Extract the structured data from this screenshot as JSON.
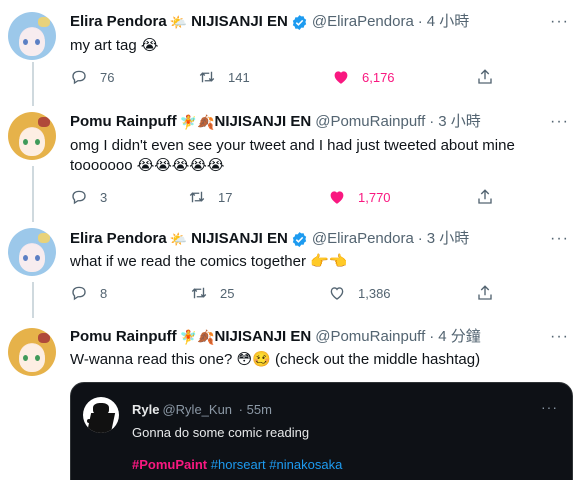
{
  "tweets": [
    {
      "name": "Elira Pendora",
      "emoji_name": "🌤️",
      "org": "NIJISANJI EN",
      "verified": true,
      "handle": "@EliraPendora",
      "time": "4 小時",
      "text": "my art tag 😭",
      "replies": "76",
      "retweets": "141",
      "likes": "6,176",
      "liked": true
    },
    {
      "name": "Pomu Rainpuff",
      "emoji_name": "🧚🍂",
      "org": "NIJISANJI EN",
      "verified": false,
      "handle": "@PomuRainpuff",
      "time": "3 小時",
      "text": "omg I didn't even see your tweet and I had just tweeted about mine tooooooo 😭😭😭😭😭",
      "replies": "3",
      "retweets": "17",
      "likes": "1,770",
      "liked": true
    },
    {
      "name": "Elira Pendora",
      "emoji_name": "🌤️",
      "org": "NIJISANJI EN",
      "verified": true,
      "handle": "@EliraPendora",
      "time": "3 小時",
      "text": "what if we read the comics together 👉👈",
      "replies": "8",
      "retweets": "25",
      "likes": "1,386",
      "liked": false
    },
    {
      "name": "Pomu Rainpuff",
      "emoji_name": "🧚🍂",
      "org": "NIJISANJI EN",
      "verified": false,
      "handle": "@PomuRainpuff",
      "time": "4 分鐘",
      "text": "W-wanna read this one? 😳🥴 (check out the middle hashtag)"
    }
  ],
  "quote": {
    "name": "Ryle",
    "handle": "@Ryle_Kun",
    "time": "55m",
    "text": "Gonna do some comic reading",
    "tags": [
      "#PomuPaint",
      "#horseart",
      "#ninakosaka"
    ]
  },
  "icons": {
    "reply": "reply-icon",
    "retweet": "retweet-icon",
    "like": "heart-icon",
    "share": "share-icon",
    "more": "more-icon",
    "verified": "verified-badge-icon"
  },
  "colors": {
    "like_active": "#f91880",
    "verified": "#1d9bf0",
    "secondary_text": "#536471",
    "thread_line": "#cfd9de",
    "quote_background": "#0e1116",
    "hashtag": "#1d9bf0"
  }
}
